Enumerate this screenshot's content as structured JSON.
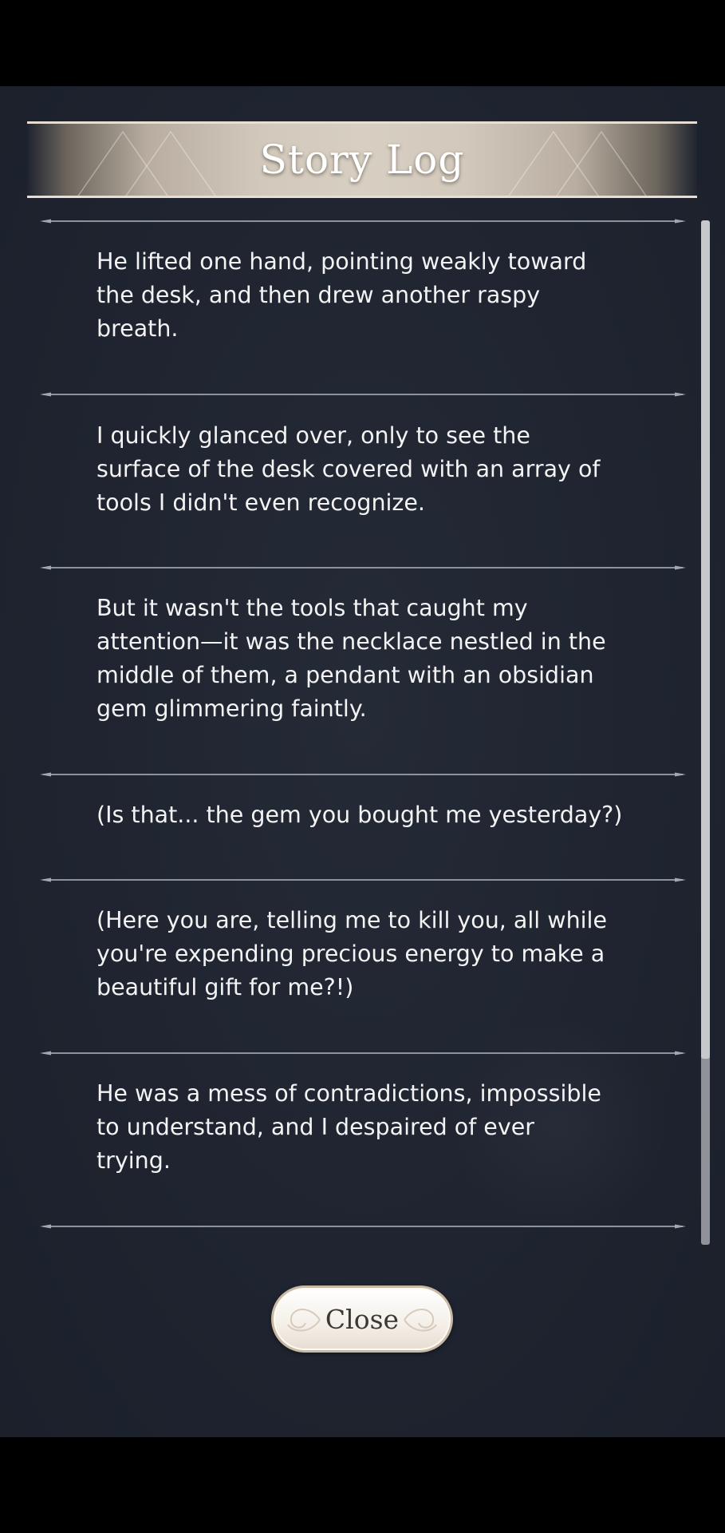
{
  "header": {
    "title": "Story Log"
  },
  "log": {
    "entries": [
      {
        "lines": [
          "He lifted one hand, pointing weakly toward",
          "the desk, and then drew another raspy",
          "breath."
        ]
      },
      {
        "lines": [
          "I quickly glanced over, only to see the",
          "surface of the desk covered with an array of",
          "tools I didn't even recognize."
        ]
      },
      {
        "lines": [
          "But it wasn't the tools that caught my",
          "attention—it was the necklace nestled in the",
          "middle of them, a pendant with an obsidian",
          "gem glimmering faintly."
        ]
      },
      {
        "lines": [
          "(Is that... the gem you bought me yesterday?)"
        ]
      },
      {
        "lines": [
          "(Here you are, telling me to kill you, all while",
          "you're expending precious energy to make a",
          "beautiful gift for me?!)"
        ]
      },
      {
        "lines": [
          "He was a mess of contradictions, impossible",
          "to understand, and I despaired of ever",
          "trying."
        ]
      }
    ]
  },
  "footer": {
    "close_label": "Close"
  },
  "colors": {
    "background": "#1f2430",
    "text": "#f3f3f3",
    "divider": "#8d939c",
    "banner": "#d2c9bc",
    "button": "#f4efe8"
  },
  "icons": {
    "divider_ends": "divider-end-ornament-icon",
    "close_flourish": "flourish-icon"
  }
}
